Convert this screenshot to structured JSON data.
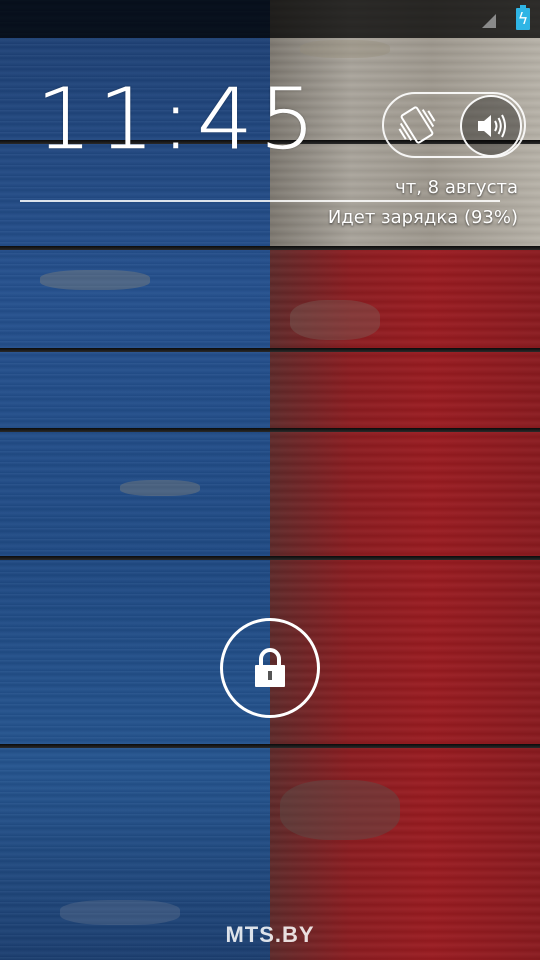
{
  "status_bar": {
    "signal_icon": "signal-icon",
    "battery_icon": "battery-charging-icon",
    "battery_color": "#2fb5e5"
  },
  "lockscreen": {
    "time": "11:45",
    "date": "чт, 8 августа",
    "charging_status": "Идет зарядка (93%)",
    "sound_mode": {
      "options": [
        "vibrate",
        "sound"
      ],
      "selected": "sound",
      "vibrate_icon": "vibrate-icon",
      "sound_icon": "speaker-icon"
    },
    "lock_icon": "padlock-icon"
  },
  "carrier": {
    "label": "MTS.BY"
  },
  "wallpaper": {
    "colors": {
      "blue": "#24508e",
      "white": "#a9a49b",
      "red": "#9a1b20"
    }
  }
}
